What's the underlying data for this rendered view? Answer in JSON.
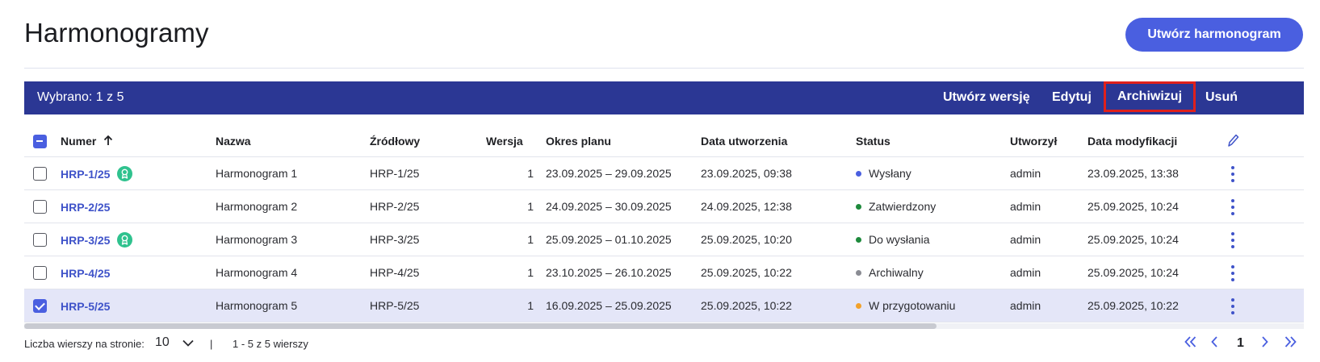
{
  "page": {
    "title": "Harmonogramy",
    "create_label": "Utwórz harmonogram"
  },
  "selection_bar": {
    "count_text": "Wybrano: 1 z 5",
    "actions": {
      "create_version": "Utwórz wersję",
      "edit": "Edytuj",
      "archive": "Archiwizuj",
      "delete": "Usuń"
    }
  },
  "table": {
    "columns": {
      "numer": "Numer",
      "nazwa": "Nazwa",
      "zrodlowy": "Źródłowy",
      "wersja": "Wersja",
      "okres": "Okres planu",
      "data_utworzenia": "Data utworzenia",
      "status": "Status",
      "utworzyl": "Utworzył",
      "data_modyfikacji": "Data modyfikacji"
    },
    "rows": [
      {
        "numer": "HRP-1/25",
        "badge": true,
        "nazwa": "Harmonogram 1",
        "zrodlowy": "HRP-1/25",
        "wersja": "1",
        "okres": "23.09.2025 – 29.09.2025",
        "data_utworzenia": "23.09.2025, 09:38",
        "status": "Wysłany",
        "status_color": "#4a5fe0",
        "utworzyl": "admin",
        "data_modyfikacji": "23.09.2025, 13:38",
        "selected": false
      },
      {
        "numer": "HRP-2/25",
        "badge": false,
        "nazwa": "Harmonogram 2",
        "zrodlowy": "HRP-2/25",
        "wersja": "1",
        "okres": "24.09.2025 – 30.09.2025",
        "data_utworzenia": "24.09.2025, 12:38",
        "status": "Zatwierdzony",
        "status_color": "#1e8a3c",
        "utworzyl": "admin",
        "data_modyfikacji": "25.09.2025, 10:24",
        "selected": false
      },
      {
        "numer": "HRP-3/25",
        "badge": true,
        "nazwa": "Harmonogram 3",
        "zrodlowy": "HRP-3/25",
        "wersja": "1",
        "okres": "25.09.2025 – 01.10.2025",
        "data_utworzenia": "25.09.2025, 10:20",
        "status": "Do wysłania",
        "status_color": "#1e8a3c",
        "utworzyl": "admin",
        "data_modyfikacji": "25.09.2025, 10:24",
        "selected": false
      },
      {
        "numer": "HRP-4/25",
        "badge": false,
        "nazwa": "Harmonogram 4",
        "zrodlowy": "HRP-4/25",
        "wersja": "1",
        "okres": "23.10.2025 – 26.10.2025",
        "data_utworzenia": "25.09.2025, 10:22",
        "status": "Archiwalny",
        "status_color": "#8a8c93",
        "utworzyl": "admin",
        "data_modyfikacji": "25.09.2025, 10:24",
        "selected": false
      },
      {
        "numer": "HRP-5/25",
        "badge": false,
        "nazwa": "Harmonogram 5",
        "zrodlowy": "HRP-5/25",
        "wersja": "1",
        "okres": "16.09.2025 – 25.09.2025",
        "data_utworzenia": "25.09.2025, 10:22",
        "status": "W przygotowaniu",
        "status_color": "#f2a12a",
        "utworzyl": "admin",
        "data_modyfikacji": "25.09.2025, 10:22",
        "selected": true
      }
    ]
  },
  "footer": {
    "rows_label": "Liczba wierszy na stronie:",
    "rows_value": "10",
    "separator": "|",
    "rows_info": "1 - 5 z 5 wierszy",
    "current_page": "1"
  },
  "colors": {
    "accent": "#4a5fe0",
    "bar": "#2b3794",
    "link": "#3f53c9",
    "highlight": "#e0201b"
  },
  "icons": [
    "sort-up-icon",
    "edit-columns-icon",
    "badge-icon",
    "kebab-icon",
    "chevron-down-icon",
    "first-page-icon",
    "prev-page-icon",
    "next-page-icon",
    "last-page-icon"
  ]
}
